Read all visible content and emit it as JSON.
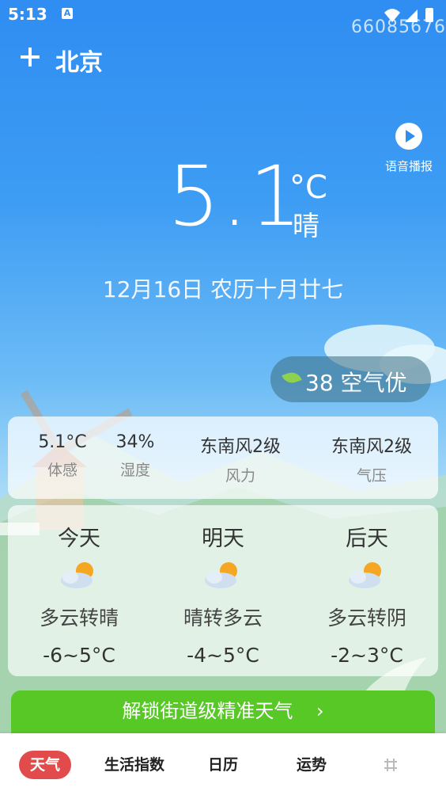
{
  "status": {
    "time": "5:13",
    "notification_badge": "A",
    "watermark": "66085676"
  },
  "header": {
    "city": "北京"
  },
  "voice": {
    "label": "语音播报"
  },
  "current": {
    "temperature": "5.1",
    "unit": "°C",
    "condition": "晴",
    "date": "12月16日 农历十月廿七"
  },
  "aqi": {
    "text": "38 空气优"
  },
  "details": [
    {
      "value": "5.1°C",
      "label": "体感"
    },
    {
      "value": "34%",
      "label": "湿度"
    },
    {
      "value": "东南风2级",
      "label": "风力"
    },
    {
      "value": "东南风2级",
      "label": "气压"
    }
  ],
  "forecast": [
    {
      "day": "今天",
      "condition": "多云转晴",
      "range": "-6~5°C",
      "icon": "partly-cloudy-icon"
    },
    {
      "day": "明天",
      "condition": "晴转多云",
      "range": "-4~5°C",
      "icon": "partly-cloudy-icon"
    },
    {
      "day": "后天",
      "condition": "多云转阴",
      "range": "-2~3°C",
      "icon": "partly-cloudy-icon"
    }
  ],
  "unlock": {
    "label": "解锁街道级精准天气"
  },
  "tabs": [
    {
      "label": "天气",
      "active": true
    },
    {
      "label": "生活指数",
      "active": false
    },
    {
      "label": "日历",
      "active": false
    },
    {
      "label": "运势",
      "active": false
    }
  ],
  "colors": {
    "sky_top": "#2f8df2",
    "accent_green": "#57c826",
    "tab_active": "#e24b4b"
  }
}
